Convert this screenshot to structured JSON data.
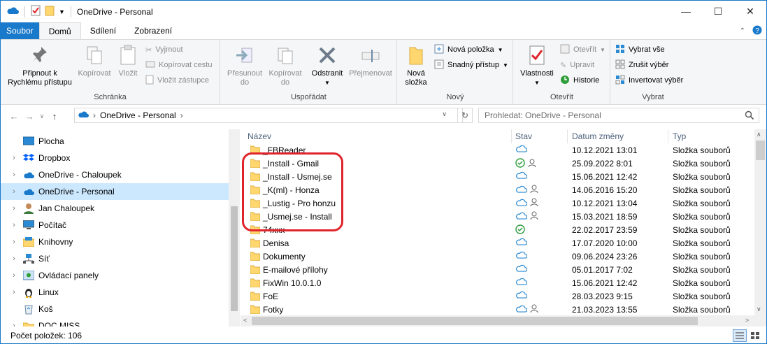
{
  "window": {
    "title": "OneDrive - Personal"
  },
  "tabs": [
    "Soubor",
    "Domů",
    "Sdílení",
    "Zobrazení"
  ],
  "ribbon": {
    "pin": "Připnout k\nRychlému přístupu",
    "copy": "Kopírovat",
    "paste": "Vložit",
    "cut": "Vyjmout",
    "copy_path": "Kopírovat cestu",
    "paste_shortcut": "Vložit zástupce",
    "group_clipboard": "Schránka",
    "move_to": "Přesunout\ndo",
    "copy_to": "Kopírovat\ndo",
    "delete": "Odstranit",
    "rename": "Přejmenovat",
    "group_organize": "Uspořádat",
    "new_folder": "Nová\nsložka",
    "new_item": "Nová položka",
    "easy_access": "Snadný přístup",
    "group_new": "Nový",
    "properties": "Vlastnosti",
    "open": "Otevřít",
    "edit": "Upravit",
    "history": "Historie",
    "group_open": "Otevřít",
    "select_all": "Vybrat vše",
    "select_none": "Zrušit výběr",
    "invert_selection": "Invertovat výběr",
    "group_select": "Vybrat"
  },
  "address": {
    "path": "OneDrive - Personal",
    "search_placeholder": "Prohledat: OneDrive - Personal"
  },
  "nav": [
    {
      "label": "Plocha",
      "icon": "desktop-icon",
      "chev": ""
    },
    {
      "label": "Dropbox",
      "icon": "dropbox-icon",
      "chev": "›"
    },
    {
      "label": "OneDrive - Chaloupek",
      "icon": "cloud-icon",
      "chev": "›"
    },
    {
      "label": "OneDrive - Personal",
      "icon": "cloud-icon",
      "chev": "›"
    },
    {
      "label": "Jan Chaloupek",
      "icon": "user-icon",
      "chev": "›"
    },
    {
      "label": "Počítač",
      "icon": "computer-icon",
      "chev": "›"
    },
    {
      "label": "Knihovny",
      "icon": "library-icon",
      "chev": "›"
    },
    {
      "label": "Síť",
      "icon": "network-icon",
      "chev": "›"
    },
    {
      "label": "Ovládací panely",
      "icon": "control-panel-icon",
      "chev": "›"
    },
    {
      "label": "Linux",
      "icon": "linux-icon",
      "chev": "›"
    },
    {
      "label": "Koš",
      "icon": "recycle-bin-icon",
      "chev": ""
    },
    {
      "label": "DOC MISS",
      "icon": "folder-icon",
      "chev": "›"
    }
  ],
  "columns": {
    "name": "Název",
    "status": "Stav",
    "date": "Datum změny",
    "type": "Typ"
  },
  "files": [
    {
      "name": "_FBReader",
      "status": "cloud",
      "date": "10.12.2021 13:01",
      "type": "Složka souborů"
    },
    {
      "name": "_Install - Gmail",
      "status": "check-shared",
      "date": "25.09.2022 8:01",
      "type": "Složka souborů"
    },
    {
      "name": "_Install - Usmej.se",
      "status": "cloud",
      "date": "15.06.2021 12:42",
      "type": "Složka souborů"
    },
    {
      "name": "_K(ml) - Honza",
      "status": "cloud-shared",
      "date": "14.06.2016 15:20",
      "type": "Složka souborů"
    },
    {
      "name": "_Lustig - Pro honzu",
      "status": "cloud-shared",
      "date": "10.12.2021 13:04",
      "type": "Složka souborů"
    },
    {
      "name": "_Usmej.se - Install",
      "status": "cloud-shared",
      "date": "15.03.2021 18:59",
      "type": "Složka souborů"
    },
    {
      "name": "74xxx",
      "status": "check",
      "date": "22.02.2017 23:59",
      "type": "Složka souborů"
    },
    {
      "name": "Denisa",
      "status": "cloud",
      "date": "17.07.2020 10:00",
      "type": "Složka souborů"
    },
    {
      "name": "Dokumenty",
      "status": "cloud",
      "date": "09.06.2024 23:26",
      "type": "Složka souborů"
    },
    {
      "name": "E-mailové přílohy",
      "status": "cloud",
      "date": "05.01.2017 7:02",
      "type": "Složka souborů"
    },
    {
      "name": "FixWin 10.0.1.0",
      "status": "cloud",
      "date": "15.06.2021 12:42",
      "type": "Složka souborů"
    },
    {
      "name": "FoE",
      "status": "cloud",
      "date": "28.03.2023 9:15",
      "type": "Složka souborů"
    },
    {
      "name": "Fotky",
      "status": "cloud-shared",
      "date": "21.03.2023 13:55",
      "type": "Složka souborů"
    }
  ],
  "statusbar": {
    "count": "Počet položek: 106"
  },
  "colors": {
    "accent": "#1979ca",
    "highlight": "#e0242b",
    "folder": "#ffd76e",
    "cloud": "#2a8ad4",
    "check": "#2e9e3a"
  }
}
